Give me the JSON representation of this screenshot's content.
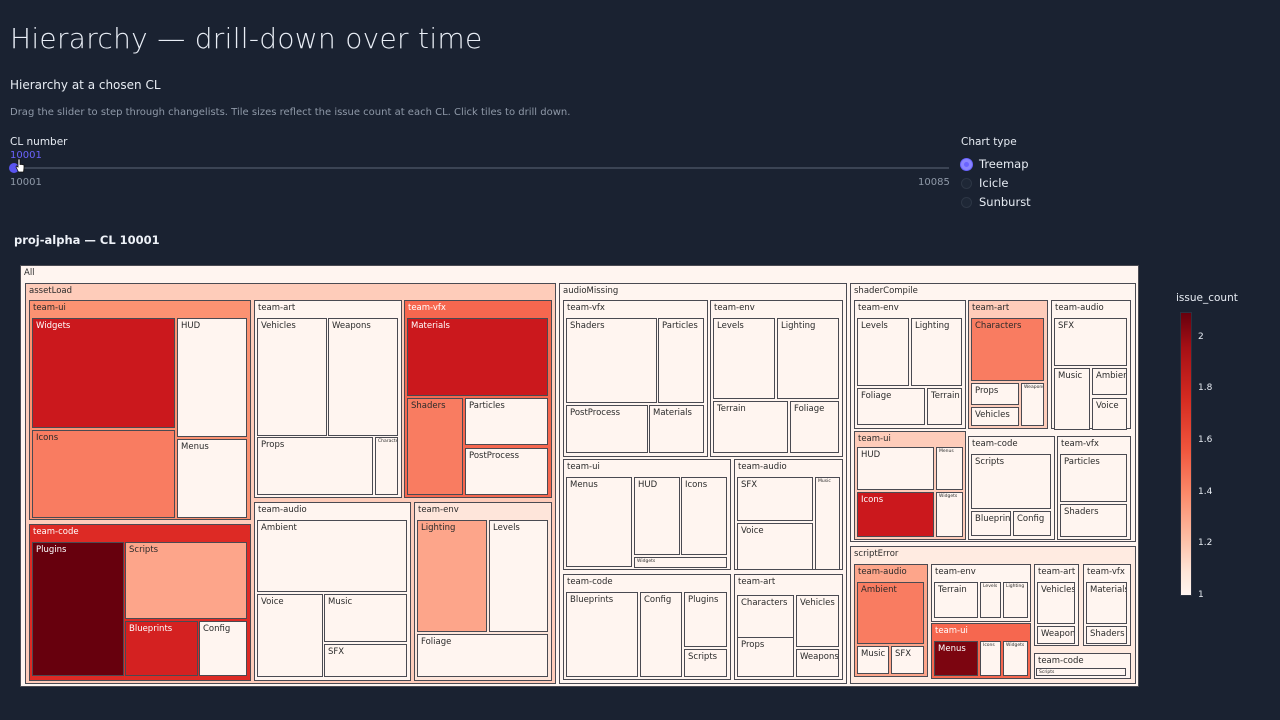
{
  "header": {
    "title": "Hierarchy — drill-down over time",
    "subtitle": "Hierarchy at a chosen CL",
    "description": "Drag the slider to step through changelists. Tile sizes reflect the issue count at each CL. Click tiles to drill down."
  },
  "slider": {
    "label": "CL number",
    "value": "10001",
    "min": "10001",
    "max": "10085",
    "position": 0
  },
  "chart_type": {
    "label": "Chart type",
    "options": [
      {
        "label": "Treemap",
        "selected": true
      },
      {
        "label": "Icicle",
        "selected": false
      },
      {
        "label": "Sunburst",
        "selected": false
      }
    ]
  },
  "chart_title": "proj-alpha — CL 10001",
  "colorbar": {
    "label": "issue_count",
    "ticks": [
      "2",
      "1.8",
      "1.6",
      "1.4",
      "1.2",
      "1"
    ],
    "min": 1,
    "max": 2.1
  },
  "chart_data": {
    "type": "treemap",
    "root": "All",
    "color_metric": "issue_count",
    "tiles": [
      {
        "id": "all",
        "label": "All",
        "value": 1.0
      },
      {
        "id": "assetLoad",
        "label": "assetLoad",
        "value": 1.25
      },
      {
        "id": "audioMissing",
        "label": "audioMissing",
        "value": 1.0
      },
      {
        "id": "shaderCompile",
        "label": "shaderCompile",
        "value": 1.0
      },
      {
        "id": "scriptError",
        "label": "scriptError",
        "value": 1.1
      },
      {
        "id": "al-ui",
        "label": "team-ui",
        "value": 1.4
      },
      {
        "id": "al-ui-widgets",
        "label": "Widgets",
        "value": 1.8
      },
      {
        "id": "al-ui-hud",
        "label": "HUD",
        "value": 1.0
      },
      {
        "id": "al-ui-icons",
        "label": "Icons",
        "value": 1.45
      },
      {
        "id": "al-ui-menus",
        "label": "Menus",
        "value": 1.0
      },
      {
        "id": "al-art",
        "label": "team-art",
        "value": 1.0
      },
      {
        "id": "al-art-vehicles",
        "label": "Vehicles",
        "value": 1.0
      },
      {
        "id": "al-art-weapons",
        "label": "Weapons",
        "value": 1.0
      },
      {
        "id": "al-art-props",
        "label": "Props",
        "value": 1.0
      },
      {
        "id": "al-art-chars",
        "label": "Characters",
        "value": 1.0
      },
      {
        "id": "al-vfx",
        "label": "team-vfx",
        "value": 1.5
      },
      {
        "id": "al-vfx-materials",
        "label": "Materials",
        "value": 1.8
      },
      {
        "id": "al-vfx-shaders",
        "label": "Shaders",
        "value": 1.45
      },
      {
        "id": "al-vfx-particles",
        "label": "Particles",
        "value": 1.0
      },
      {
        "id": "al-vfx-postprocess",
        "label": "PostProcess",
        "value": 1.0
      },
      {
        "id": "al-code",
        "label": "team-code",
        "value": 1.7
      },
      {
        "id": "al-code-plugins",
        "label": "Plugins",
        "value": 2.1
      },
      {
        "id": "al-code-scripts",
        "label": "Scripts",
        "value": 1.35
      },
      {
        "id": "al-code-blueprints",
        "label": "Blueprints",
        "value": 1.75
      },
      {
        "id": "al-code-config",
        "label": "Config",
        "value": 1.0
      },
      {
        "id": "al-audio",
        "label": "team-audio",
        "value": 1.0
      },
      {
        "id": "al-audio-ambient",
        "label": "Ambient",
        "value": 1.0
      },
      {
        "id": "al-audio-voice",
        "label": "Voice",
        "value": 1.0
      },
      {
        "id": "al-audio-music",
        "label": "Music",
        "value": 1.0
      },
      {
        "id": "al-audio-sfx",
        "label": "SFX",
        "value": 1.0
      },
      {
        "id": "al-env",
        "label": "team-env",
        "value": 1.15
      },
      {
        "id": "al-env-lighting",
        "label": "Lighting",
        "value": 1.35
      },
      {
        "id": "al-env-levels",
        "label": "Levels",
        "value": 1.0
      },
      {
        "id": "al-env-foliage",
        "label": "Foliage",
        "value": 1.0
      },
      {
        "id": "am-vfx",
        "label": "team-vfx",
        "value": 1.0
      },
      {
        "id": "am-vfx-shaders",
        "label": "Shaders",
        "value": 1.0
      },
      {
        "id": "am-vfx-particles",
        "label": "Particles",
        "value": 1.0
      },
      {
        "id": "am-vfx-postprocess",
        "label": "PostProcess",
        "value": 1.0
      },
      {
        "id": "am-vfx-materials",
        "label": "Materials",
        "value": 1.0
      },
      {
        "id": "am-env",
        "label": "team-env",
        "value": 1.0
      },
      {
        "id": "am-env-levels",
        "label": "Levels",
        "value": 1.0
      },
      {
        "id": "am-env-lighting",
        "label": "Lighting",
        "value": 1.0
      },
      {
        "id": "am-env-terrain",
        "label": "Terrain",
        "value": 1.0
      },
      {
        "id": "am-env-foliage",
        "label": "Foliage",
        "value": 1.0
      },
      {
        "id": "am-ui",
        "label": "team-ui",
        "value": 1.0
      },
      {
        "id": "am-ui-menus",
        "label": "Menus",
        "value": 1.0
      },
      {
        "id": "am-ui-hud",
        "label": "HUD",
        "value": 1.0
      },
      {
        "id": "am-ui-icons",
        "label": "Icons",
        "value": 1.0
      },
      {
        "id": "am-ui-widgets",
        "label": "Widgets",
        "value": 1.0
      },
      {
        "id": "am-audio",
        "label": "team-audio",
        "value": 1.0
      },
      {
        "id": "am-audio-sfx",
        "label": "SFX",
        "value": 1.0
      },
      {
        "id": "am-audio-music",
        "label": "Music",
        "value": 1.0
      },
      {
        "id": "am-audio-voice",
        "label": "Voice",
        "value": 1.0
      },
      {
        "id": "am-code",
        "label": "team-code",
        "value": 1.0
      },
      {
        "id": "am-code-blueprints",
        "label": "Blueprints",
        "value": 1.0
      },
      {
        "id": "am-code-config",
        "label": "Config",
        "value": 1.0
      },
      {
        "id": "am-code-plugins",
        "label": "Plugins",
        "value": 1.0
      },
      {
        "id": "am-code-scripts",
        "label": "Scripts",
        "value": 1.0
      },
      {
        "id": "am-art",
        "label": "team-art",
        "value": 1.0
      },
      {
        "id": "am-art-characters",
        "label": "Characters",
        "value": 1.0
      },
      {
        "id": "am-art-vehicles",
        "label": "Vehicles",
        "value": 1.0
      },
      {
        "id": "am-art-props",
        "label": "Props",
        "value": 1.0
      },
      {
        "id": "am-art-weapons",
        "label": "Weapons",
        "value": 1.0
      },
      {
        "id": "sc-env",
        "label": "team-env",
        "value": 1.0
      },
      {
        "id": "sc-env-levels",
        "label": "Levels",
        "value": 1.0
      },
      {
        "id": "sc-env-lighting",
        "label": "Lighting",
        "value": 1.0
      },
      {
        "id": "sc-env-foliage",
        "label": "Foliage",
        "value": 1.0
      },
      {
        "id": "sc-env-terrain",
        "label": "Terrain",
        "value": 1.0
      },
      {
        "id": "sc-art",
        "label": "team-art",
        "value": 1.25
      },
      {
        "id": "sc-art-characters",
        "label": "Characters",
        "value": 1.45
      },
      {
        "id": "sc-art-props",
        "label": "Props",
        "value": 1.0
      },
      {
        "id": "sc-art-weapons",
        "label": "Weapons",
        "value": 1.0
      },
      {
        "id": "sc-art-vehicles",
        "label": "Vehicles",
        "value": 1.0
      },
      {
        "id": "sc-audio",
        "label": "team-audio",
        "value": 1.0
      },
      {
        "id": "sc-audio-sfx",
        "label": "SFX",
        "value": 1.0
      },
      {
        "id": "sc-audio-music",
        "label": "Music",
        "value": 1.0
      },
      {
        "id": "sc-audio-ambient",
        "label": "Ambient",
        "value": 1.0
      },
      {
        "id": "sc-audio-voice",
        "label": "Voice",
        "value": 1.0
      },
      {
        "id": "sc-ui",
        "label": "team-ui",
        "value": 1.25
      },
      {
        "id": "sc-ui-hud",
        "label": "HUD",
        "value": 1.0
      },
      {
        "id": "sc-ui-menus",
        "label": "Menus",
        "value": 1.0
      },
      {
        "id": "sc-ui-icons",
        "label": "Icons",
        "value": 1.8
      },
      {
        "id": "sc-ui-widgets",
        "label": "Widgets",
        "value": 1.0
      },
      {
        "id": "sc-code",
        "label": "team-code",
        "value": 1.0
      },
      {
        "id": "sc-code-scripts",
        "label": "Scripts",
        "value": 1.0
      },
      {
        "id": "sc-code-blueprints",
        "label": "Blueprints",
        "value": 1.0
      },
      {
        "id": "sc-code-config",
        "label": "Config",
        "value": 1.0
      },
      {
        "id": "sc-vfx",
        "label": "team-vfx",
        "value": 1.0
      },
      {
        "id": "sc-vfx-particles",
        "label": "Particles",
        "value": 1.0
      },
      {
        "id": "sc-vfx-shaders",
        "label": "Shaders",
        "value": 1.0
      },
      {
        "id": "se-audio",
        "label": "team-audio",
        "value": 1.35
      },
      {
        "id": "se-audio-ambient",
        "label": "Ambient",
        "value": 1.45
      },
      {
        "id": "se-audio-music",
        "label": "Music",
        "value": 1.0
      },
      {
        "id": "se-audio-sfx",
        "label": "SFX",
        "value": 1.0
      },
      {
        "id": "se-env",
        "label": "team-env",
        "value": 1.0
      },
      {
        "id": "se-env-terrain",
        "label": "Terrain",
        "value": 1.0
      },
      {
        "id": "se-env-levels",
        "label": "Levels",
        "value": 1.0
      },
      {
        "id": "se-env-lighting",
        "label": "Lighting",
        "value": 1.0
      },
      {
        "id": "se-art",
        "label": "team-art",
        "value": 1.0
      },
      {
        "id": "se-art-vehicles",
        "label": "Vehicles",
        "value": 1.0
      },
      {
        "id": "se-art-weapons",
        "label": "Weapons",
        "value": 1.0
      },
      {
        "id": "se-vfx",
        "label": "team-vfx",
        "value": 1.0
      },
      {
        "id": "se-vfx-materials",
        "label": "Materials",
        "value": 1.0
      },
      {
        "id": "se-vfx-shaders",
        "label": "Shaders",
        "value": 1.0
      },
      {
        "id": "se-ui",
        "label": "team-ui",
        "value": 1.5
      },
      {
        "id": "se-ui-menus",
        "label": "Menus",
        "value": 2.05
      },
      {
        "id": "se-ui-icons",
        "label": "Icons",
        "value": 1.0
      },
      {
        "id": "se-ui-widgets",
        "label": "Widgets",
        "value": 1.0
      },
      {
        "id": "se-code",
        "label": "team-code",
        "value": 1.0
      },
      {
        "id": "se-code-scripts",
        "label": "Scripts",
        "value": 1.0
      }
    ]
  }
}
